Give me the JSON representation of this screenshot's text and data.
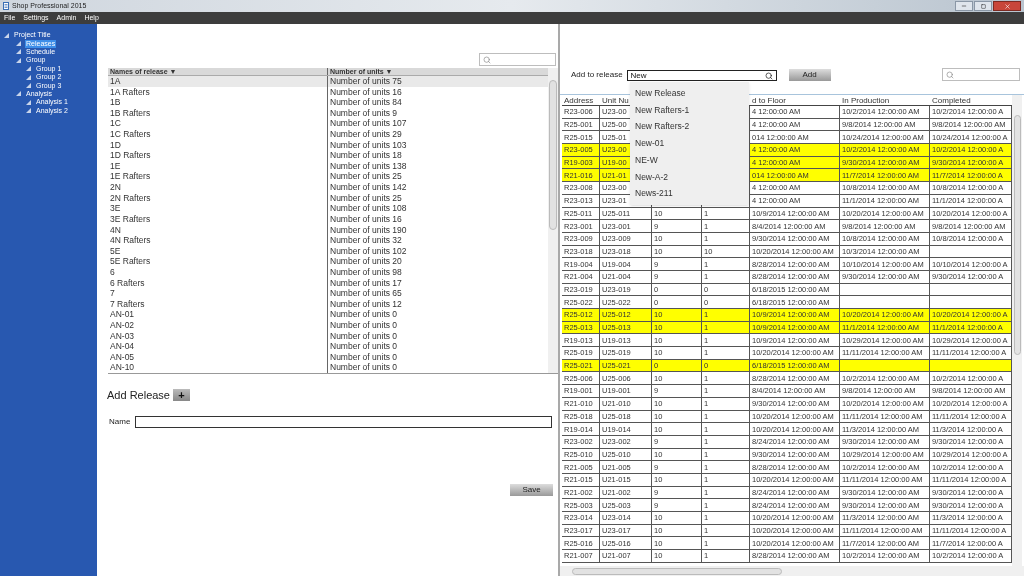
{
  "window": {
    "title": "Shop Professional 2015"
  },
  "menu": [
    "File",
    "Settings",
    "Admin",
    "Help"
  ],
  "tree": [
    {
      "label": "Project Title",
      "selected": false,
      "children": [
        {
          "label": "Releases",
          "selected": true
        },
        {
          "label": "Schedule",
          "selected": false
        },
        {
          "label": "Group",
          "selected": false,
          "children": [
            {
              "label": "Group 1",
              "selected": false
            },
            {
              "label": "Group 2",
              "selected": false
            },
            {
              "label": "Group 3",
              "selected": false
            }
          ]
        },
        {
          "label": "Analysis",
          "selected": false,
          "children": [
            {
              "label": "Analysis 1",
              "selected": false
            },
            {
              "label": "Analysis 2",
              "selected": false
            }
          ]
        }
      ]
    }
  ],
  "releases": {
    "columns": [
      "Names of release ▼",
      "Number of units ▼"
    ],
    "rows": [
      {
        "name": "1A",
        "units": "Number of units 75",
        "selected": true
      },
      {
        "name": "1A Rafters",
        "units": "Number of units 16",
        "selected": false
      },
      {
        "name": "1B",
        "units": "Number of units 84",
        "selected": false
      },
      {
        "name": "1B Rafters",
        "units": "Number of units 9",
        "selected": false
      },
      {
        "name": "1C",
        "units": "Number of units 107",
        "selected": false
      },
      {
        "name": "1C Rafters",
        "units": "Number of units 29",
        "selected": false
      },
      {
        "name": "1D",
        "units": "Number of units 103",
        "selected": false
      },
      {
        "name": "1D Rafters",
        "units": "Number of units 18",
        "selected": false
      },
      {
        "name": "1E",
        "units": "Number of units 138",
        "selected": false
      },
      {
        "name": "1E Rafters",
        "units": "Number of units 25",
        "selected": false
      },
      {
        "name": "2N",
        "units": "Number of units 142",
        "selected": false
      },
      {
        "name": "2N Rafters",
        "units": "Number of units 25",
        "selected": false
      },
      {
        "name": "3E",
        "units": "Number of units 108",
        "selected": false
      },
      {
        "name": "3E Rafters",
        "units": "Number of units 16",
        "selected": false
      },
      {
        "name": "4N",
        "units": "Number of units 190",
        "selected": false
      },
      {
        "name": "4N Rafters",
        "units": "Number of units 32",
        "selected": false
      },
      {
        "name": "5E",
        "units": "Number of units 102",
        "selected": false
      },
      {
        "name": "5E Rafters",
        "units": "Number of units 20",
        "selected": false
      },
      {
        "name": "6",
        "units": "Number of units 98",
        "selected": false
      },
      {
        "name": "6 Rafters",
        "units": "Number of units 17",
        "selected": false
      },
      {
        "name": "7",
        "units": "Number of units 65",
        "selected": false
      },
      {
        "name": "7 Rafters",
        "units": "Number of units 12",
        "selected": false
      },
      {
        "name": "AN-01",
        "units": "Number of units 0",
        "selected": false
      },
      {
        "name": "AN-02",
        "units": "Number of units 0",
        "selected": false
      },
      {
        "name": "AN-03",
        "units": "Number of units 0",
        "selected": false
      },
      {
        "name": "AN-04",
        "units": "Number of units 0",
        "selected": false
      },
      {
        "name": "AN-05",
        "units": "Number of units 0",
        "selected": false
      },
      {
        "name": "AN-10",
        "units": "Number of units 0",
        "selected": false
      }
    ]
  },
  "add_release": {
    "title": "Add Release",
    "add_button": "+",
    "name_label": "Name",
    "save_button": "Save"
  },
  "assign": {
    "label": "Add to release",
    "value": "New",
    "button": "Add",
    "suggestions": [
      "New Release",
      "New Rafters-1",
      "New Rafters-2",
      "New-01",
      "NE-W",
      "New-A-2",
      "News-211"
    ]
  },
  "units": {
    "columns": [
      "Address",
      "Unit Nu",
      null,
      null,
      "d to Floor",
      "In Production",
      "Completed"
    ],
    "rows": [
      {
        "highlighted": false,
        "cells": [
          "R23-006",
          "U23-00",
          null,
          null,
          "4 12:00:00 AM",
          "10/2/2014 12:00:00 AM",
          "10/2/2014 12:00:00 A"
        ]
      },
      {
        "highlighted": false,
        "cells": [
          "R25-001",
          "U25-00",
          null,
          null,
          "4 12:00:00 AM",
          "9/8/2014 12:00:00 AM",
          "9/8/2014 12:00:00 AM"
        ]
      },
      {
        "highlighted": false,
        "cells": [
          "R25-015",
          "U25-01",
          null,
          null,
          "014 12:00:00 AM",
          "10/24/2014 12:00:00 AM",
          "10/24/2014 12:00:00 A"
        ]
      },
      {
        "highlighted": true,
        "cells": [
          "R23-005",
          "U23-00",
          null,
          null,
          "4 12:00:00 AM",
          "10/2/2014 12:00:00 AM",
          "10/2/2014 12:00:00 A"
        ]
      },
      {
        "highlighted": true,
        "cells": [
          "R19-003",
          "U19-00",
          null,
          null,
          "4 12:00:00 AM",
          "9/30/2014 12:00:00 AM",
          "9/30/2014 12:00:00 A"
        ]
      },
      {
        "highlighted": true,
        "cells": [
          "R21-016",
          "U21-01",
          null,
          null,
          "014 12:00:00 AM",
          "11/7/2014 12:00:00 AM",
          "11/7/2014 12:00:00 A"
        ]
      },
      {
        "highlighted": false,
        "cells": [
          "R23-008",
          "U23-00",
          null,
          null,
          "4 12:00:00 AM",
          "10/8/2014 12:00:00 AM",
          "10/8/2014 12:00:00 A"
        ]
      },
      {
        "highlighted": false,
        "cells": [
          "R23-013",
          "U23-01",
          null,
          null,
          "4 12:00:00 AM",
          "11/1/2014 12:00:00 AM",
          "11/1/2014 12:00:00 A"
        ]
      },
      {
        "highlighted": false,
        "cells": [
          "R25-011",
          "U25-011",
          "10",
          "1",
          "10/9/2014 12:00:00 AM",
          "10/20/2014 12:00:00 AM",
          "10/20/2014 12:00:00 A"
        ]
      },
      {
        "highlighted": false,
        "cells": [
          "R23-001",
          "U23-001",
          "9",
          "1",
          "8/4/2014 12:00:00 AM",
          "9/8/2014 12:00:00 AM",
          "9/8/2014 12:00:00 AM"
        ]
      },
      {
        "highlighted": false,
        "cells": [
          "R23-009",
          "U23-009",
          "10",
          "1",
          "9/30/2014 12:00:00 AM",
          "10/8/2014 12:00:00 AM",
          "10/8/2014 12:00:00 A"
        ]
      },
      {
        "highlighted": false,
        "cells": [
          "R23-018",
          "U23-018",
          "10",
          "10",
          "10/20/2014 12:00:00 AM",
          "10/3/2014 12:00:00 AM",
          null
        ]
      },
      {
        "highlighted": false,
        "cells": [
          "R19-004",
          "U19-004",
          "9",
          "1",
          "8/28/2014 12:00:00 AM",
          "10/10/2014 12:00:00 AM",
          "10/10/2014 12:00:00 A"
        ]
      },
      {
        "highlighted": false,
        "cells": [
          "R21-004",
          "U21-004",
          "9",
          "1",
          "8/28/2014 12:00:00 AM",
          "9/30/2014 12:00:00 AM",
          "9/30/2014 12:00:00 A"
        ]
      },
      {
        "highlighted": false,
        "cells": [
          "R23-019",
          "U23-019",
          "0",
          "0",
          "6/18/2015 12:00:00 AM",
          null,
          null
        ]
      },
      {
        "highlighted": false,
        "cells": [
          "R25-022",
          "U25-022",
          "0",
          "0",
          "6/18/2015 12:00:00 AM",
          null,
          null
        ]
      },
      {
        "highlighted": true,
        "cells": [
          "R25-012",
          "U25-012",
          "10",
          "1",
          "10/9/2014 12:00:00 AM",
          "10/20/2014 12:00:00 AM",
          "10/20/2014 12:00:00 A"
        ]
      },
      {
        "highlighted": true,
        "cells": [
          "R25-013",
          "U25-013",
          "10",
          "1",
          "10/9/2014 12:00:00 AM",
          "11/1/2014 12:00:00 AM",
          "11/1/2014 12:00:00 A"
        ]
      },
      {
        "highlighted": false,
        "cells": [
          "R19-013",
          "U19-013",
          "10",
          "1",
          "10/9/2014 12:00:00 AM",
          "10/29/2014 12:00:00 AM",
          "10/29/2014 12:00:00 A"
        ]
      },
      {
        "highlighted": false,
        "cells": [
          "R25-019",
          "U25-019",
          "10",
          "1",
          "10/20/2014 12:00:00 AM",
          "11/11/2014 12:00:00 AM",
          "11/11/2014 12:00:00 A"
        ]
      },
      {
        "highlighted": true,
        "cells": [
          "R25-021",
          "U25-021",
          "0",
          "0",
          "6/18/2015 12:00:00 AM",
          null,
          null
        ]
      },
      {
        "highlighted": false,
        "cells": [
          "R25-006",
          "U25-006",
          "10",
          "1",
          "8/28/2014 12:00:00 AM",
          "10/2/2014 12:00:00 AM",
          "10/2/2014 12:00:00 A"
        ]
      },
      {
        "highlighted": false,
        "cells": [
          "R19-001",
          "U19-001",
          "9",
          "1",
          "8/4/2014 12:00:00 AM",
          "9/8/2014 12:00:00 AM",
          "9/8/2014 12:00:00 AM"
        ]
      },
      {
        "highlighted": false,
        "cells": [
          "R21-010",
          "U21-010",
          "10",
          "1",
          "9/30/2014 12:00:00 AM",
          "10/20/2014 12:00:00 AM",
          "10/20/2014 12:00:00 A"
        ]
      },
      {
        "highlighted": false,
        "cells": [
          "R25-018",
          "U25-018",
          "10",
          "1",
          "10/20/2014 12:00:00 AM",
          "11/11/2014 12:00:00 AM",
          "11/11/2014 12:00:00 A"
        ]
      },
      {
        "highlighted": false,
        "cells": [
          "R19-014",
          "U19-014",
          "10",
          "1",
          "10/20/2014 12:00:00 AM",
          "11/3/2014 12:00:00 AM",
          "11/3/2014 12:00:00 A"
        ]
      },
      {
        "highlighted": false,
        "cells": [
          "R23-002",
          "U23-002",
          "9",
          "1",
          "8/24/2014 12:00:00 AM",
          "9/30/2014 12:00:00 AM",
          "9/30/2014 12:00:00 A"
        ]
      },
      {
        "highlighted": false,
        "cells": [
          "R25-010",
          "U25-010",
          "10",
          "1",
          "9/30/2014 12:00:00 AM",
          "10/29/2014 12:00:00 AM",
          "10/29/2014 12:00:00 A"
        ]
      },
      {
        "highlighted": false,
        "cells": [
          "R21-005",
          "U21-005",
          "9",
          "1",
          "8/28/2014 12:00:00 AM",
          "10/2/2014 12:00:00 AM",
          "10/2/2014 12:00:00 A"
        ]
      },
      {
        "highlighted": false,
        "cells": [
          "R21-015",
          "U21-015",
          "10",
          "1",
          "10/20/2014 12:00:00 AM",
          "11/11/2014 12:00:00 AM",
          "11/11/2014 12:00:00 A"
        ]
      },
      {
        "highlighted": false,
        "cells": [
          "R21-002",
          "U21-002",
          "9",
          "1",
          "8/24/2014 12:00:00 AM",
          "9/30/2014 12:00:00 AM",
          "9/30/2014 12:00:00 A"
        ]
      },
      {
        "highlighted": false,
        "cells": [
          "R25-003",
          "U25-003",
          "9",
          "1",
          "8/24/2014 12:00:00 AM",
          "9/30/2014 12:00:00 AM",
          "9/30/2014 12:00:00 A"
        ]
      },
      {
        "highlighted": false,
        "cells": [
          "R23-014",
          "U23-014",
          "10",
          "1",
          "10/20/2014 12:00:00 AM",
          "11/3/2014 12:00:00 AM",
          "11/3/2014 12:00:00 A"
        ]
      },
      {
        "highlighted": false,
        "cells": [
          "R23-017",
          "U23-017",
          "10",
          "1",
          "10/20/2014 12:00:00 AM",
          "11/11/2014 12:00:00 AM",
          "11/11/2014 12:00:00 A"
        ]
      },
      {
        "highlighted": false,
        "cells": [
          "R25-016",
          "U25-016",
          "10",
          "1",
          "10/20/2014 12:00:00 AM",
          "11/7/2014 12:00:00 AM",
          "11/7/2014 12:00:00 A"
        ]
      },
      {
        "highlighted": false,
        "cells": [
          "R21-007",
          "U21-007",
          "10",
          "1",
          "8/28/2014 12:00:00 AM",
          "10/2/2014 12:00:00 AM",
          "10/2/2014 12:00:00 A"
        ]
      }
    ]
  }
}
